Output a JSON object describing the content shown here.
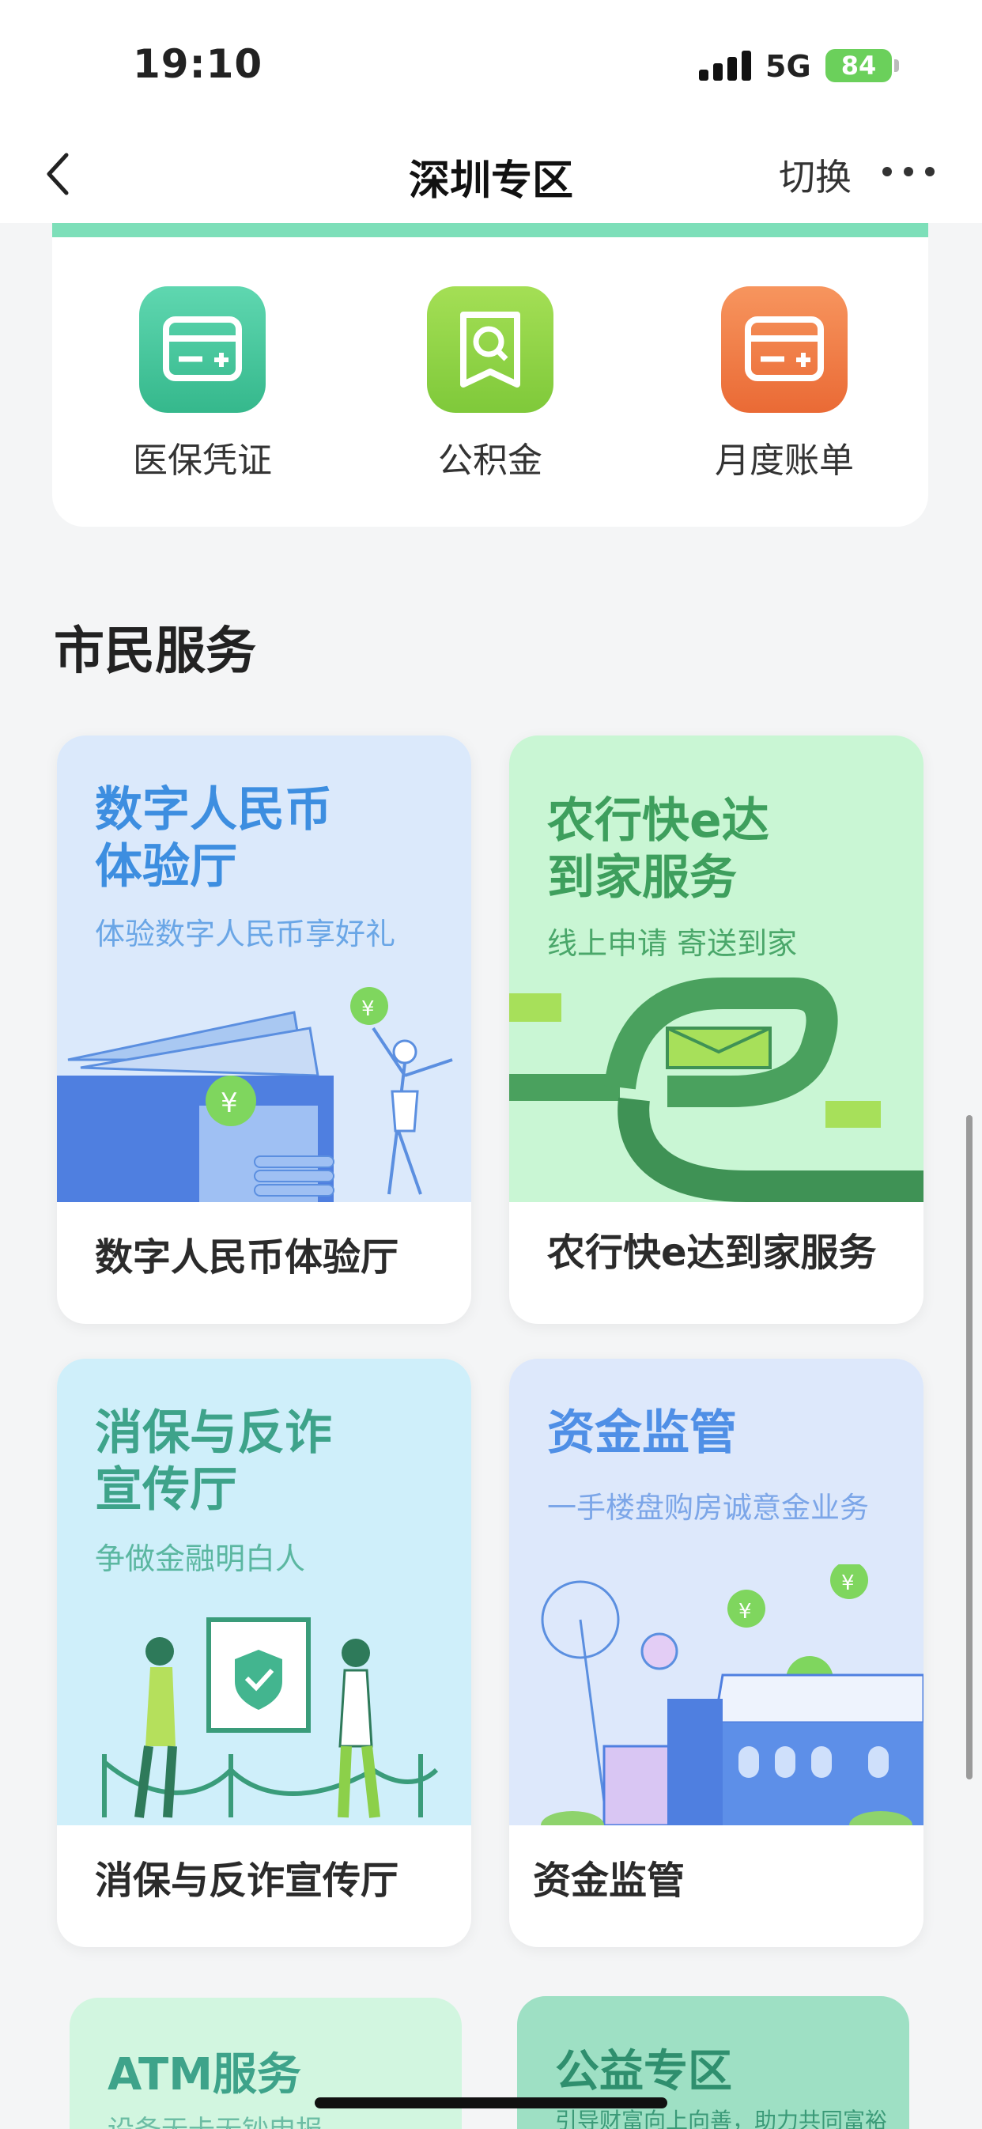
{
  "status": {
    "time": "19:10",
    "network": "5G",
    "battery": "84"
  },
  "nav": {
    "title": "深圳专区",
    "switch_label": "切换"
  },
  "quick_actions": [
    {
      "label": "医保凭证",
      "icon": "card-icon",
      "color": "#3fc397"
    },
    {
      "label": "公积金",
      "icon": "document-search-icon",
      "color": "#8dd23e"
    },
    {
      "label": "月度账单",
      "icon": "bill-card-icon",
      "color": "#ef7640"
    }
  ],
  "section": {
    "title": "市民服务"
  },
  "tiles": [
    {
      "title_l1": "数字人民币",
      "title_l2": "体验厅",
      "subtitle": "体验数字人民币享好礼",
      "footer": "数字人民币体验厅"
    },
    {
      "title_l1": "农行快e达",
      "title_l2": "到家服务",
      "subtitle": "线上申请 寄送到家",
      "footer": "农行快e达到家服务"
    },
    {
      "title_l1": "消保与反诈",
      "title_l2": "宣传厅",
      "subtitle": "争做金融明白人",
      "footer": "消保与反诈宣传厅"
    },
    {
      "title_l1": "资金监管",
      "title_l2": "",
      "subtitle": "一手楼盘购房诚意金业务",
      "footer": "资金监管"
    }
  ],
  "partial_tiles": [
    {
      "title": "ATM服务",
      "subtitle": "设备无卡无钞申报"
    },
    {
      "title": "公益专区",
      "subtitle": "引导财富向上向善，助力共同富裕"
    }
  ],
  "colors": {
    "accent_green": "#3aa163",
    "accent_blue": "#4f8fe6"
  }
}
